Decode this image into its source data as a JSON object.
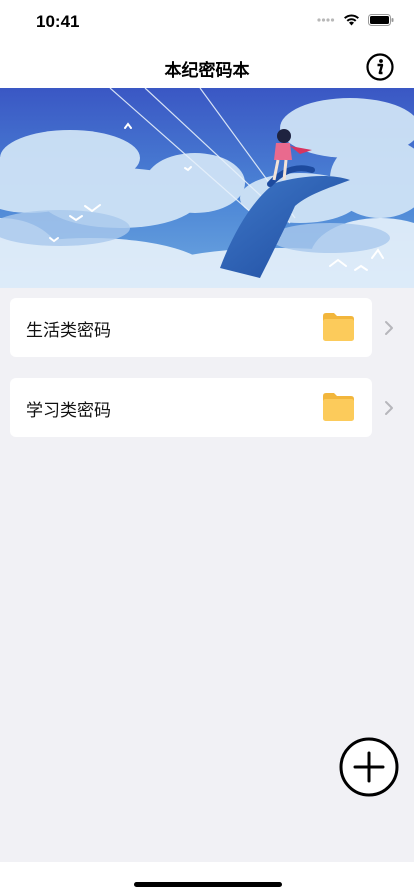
{
  "status_bar": {
    "time": "10:41"
  },
  "nav": {
    "title": "本纪密码本"
  },
  "categories": [
    {
      "label": "生活类密码"
    },
    {
      "label": "学习类密码"
    }
  ],
  "icons": {
    "info": "info-icon",
    "folder": "folder-icon",
    "chevron": "chevron-right-icon",
    "add": "plus-circle-icon"
  },
  "colors": {
    "background": "#f1f1f5",
    "folder": "#fccb5b",
    "sky": "#3f62c8"
  }
}
